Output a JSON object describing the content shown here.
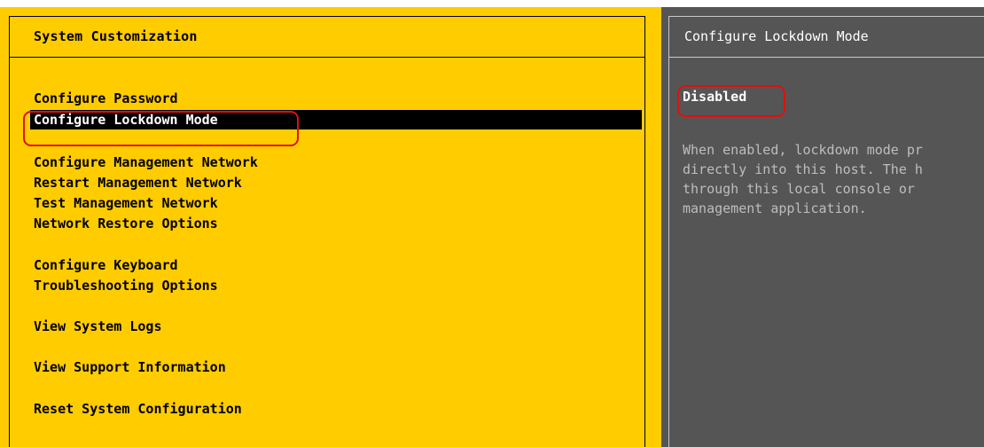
{
  "window": {
    "left_title": "System Customization",
    "right_title": "Configure Lockdown Mode"
  },
  "menu": {
    "items": [
      "Configure Password",
      "Configure Lockdown Mode",
      "Configure Management Network",
      "Restart Management Network",
      "Test Management Network",
      "Network Restore Options",
      "Configure Keyboard",
      "Troubleshooting Options",
      "View System Logs",
      "View Support Information",
      "Reset System Configuration"
    ],
    "selected": "Configure Lockdown Mode"
  },
  "details": {
    "status": "Disabled",
    "description_lines": [
      "When enabled, lockdown mode pr",
      "directly into this host. The h",
      "through this local console or",
      "management application."
    ]
  },
  "colors": {
    "left_background": "#ffcc00",
    "right_background": "#555555",
    "selection": "#000000",
    "annotation_red": "#e01010"
  }
}
